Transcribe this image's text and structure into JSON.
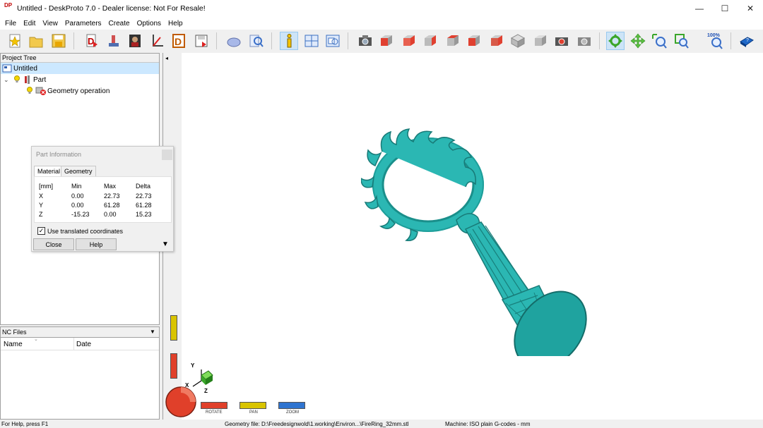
{
  "window": {
    "title": "Untitled - DeskProto 7.0 - Dealer license: Not For Resale!",
    "logo_text": "DP",
    "minimize_glyph": "—",
    "maximize_glyph": "☐",
    "close_glyph": "✕"
  },
  "menu": [
    "File",
    "Edit",
    "View",
    "Parameters",
    "Create",
    "Options",
    "Help"
  ],
  "toolbar": {
    "zoom_label": "100%",
    "icons": [
      "new-file-icon",
      "open-folder-icon",
      "save-icon",
      "part-icon",
      "import-geometry-icon",
      "image-icon",
      "vector-icon",
      "dxf-icon",
      "export-icon",
      "shape-icon",
      "search-icon",
      "info-icon",
      "layout-icon",
      "window-icon",
      "camera-icon",
      "view-front-icon",
      "view-back-icon",
      "view-left-icon",
      "view-right-icon",
      "view-top-icon",
      "view-bottom-icon",
      "view-iso-icon",
      "view-iso2-icon",
      "screenshot-icon",
      "screenshot2-icon",
      "rotate-mode-icon",
      "pan-mode-icon",
      "zoom-mode-icon",
      "zoom-window-icon",
      "zoom-100-icon",
      "help-book-icon"
    ]
  },
  "project_tree": {
    "header": "Project Tree",
    "root": "Untitled",
    "part": "Part",
    "operation": "Geometry operation"
  },
  "nc_files": {
    "header": "NC Files",
    "col_name": "Name",
    "col_date": "Date"
  },
  "part_info": {
    "title": "Part Information",
    "tabs": [
      "Material",
      "Geometry"
    ],
    "headers": [
      "[mm]",
      "Min",
      "Max",
      "Delta"
    ],
    "rows": [
      {
        "axis": "X",
        "min": "0.00",
        "max": "22.73",
        "delta": "22.73"
      },
      {
        "axis": "Y",
        "min": "0.00",
        "max": "61.28",
        "delta": "61.28"
      },
      {
        "axis": "Z",
        "min": "-15.23",
        "max": "0.00",
        "delta": "15.23"
      }
    ],
    "checkbox_label": "Use translated coordinates",
    "checkbox_checked": true,
    "close_button": "Close",
    "help_button": "Help"
  },
  "viewport": {
    "model_color": "#2bb7b3",
    "axis_x": "X",
    "axis_y": "Y",
    "axis_z": "Z",
    "mode_labels": [
      "ROTATE",
      "PAN",
      "ZOOM"
    ]
  },
  "status": {
    "help": "For Help, press F1",
    "geometry": "Geometry file: D:\\Freedesignwold\\1.working\\Environ...\\FireRing_32mm.stl",
    "machine": "Machine: ISO plain G-codes - mm"
  }
}
